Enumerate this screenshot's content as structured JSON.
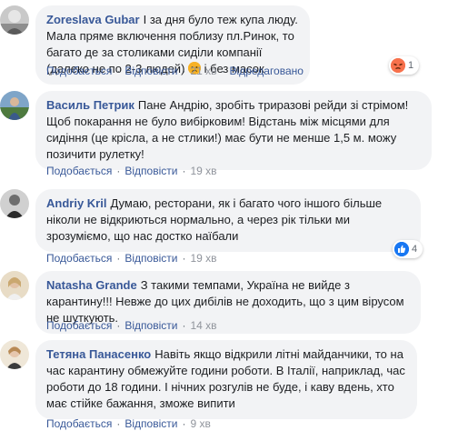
{
  "actions": {
    "like": "Подобається",
    "reply": "Відповісти",
    "edited": "Відредаговано",
    "separator": "·"
  },
  "comments": [
    {
      "author": "Zoreslava Gubar",
      "text": "І за дня було теж купа люду. Мала пряме включення поблизу пл.Ринок, то багато де за столиками сиділи компанії (далеко не по 2-3 людей)",
      "text_after_emoji": " і без масок",
      "inline_emoji": "sad-face-emoji",
      "time": "21 хв",
      "reaction": {
        "icon": "angry-reaction",
        "count": "1",
        "color": "#f7714c"
      }
    },
    {
      "author": "Василь Петрик",
      "text": "Пане Андрію, зробіть триразові рейди зі стрімом! Щоб покарання не було вибірковим! Відстань між місцями для сидіння (це крісла, а не стлики!) має бути не менше 1,5 м. можу позичити рулетку!",
      "time": "19 хв"
    },
    {
      "author": "Andriy Kril",
      "text": "Думаю, ресторани, як і багато чого іншого більше ніколи не відкриються нормально, а через рік тільки ми зрозуміємо, що нас достко наїбали",
      "time": "19 хв",
      "reaction": {
        "icon": "like-reaction",
        "count": "4",
        "color": "#1877f2"
      }
    },
    {
      "author": "Natasha Grande",
      "text": "З такими темпами, Україна не вийде з карантину!!! Невже до цих дибілів не доходить, що з цим вірусом не шуткують.",
      "time": "14 хв"
    },
    {
      "author": "Тетяна Панасенко",
      "text": "Навіть якщо відкрили літні майданчики, то на час карантину обмежуйте години роботи. В Італії, наприклад, час роботи до 18 години. І нічних розгулів не буде, і каву вдень, хто має стійке бажання, зможе випити",
      "time": "9 хв"
    }
  ]
}
